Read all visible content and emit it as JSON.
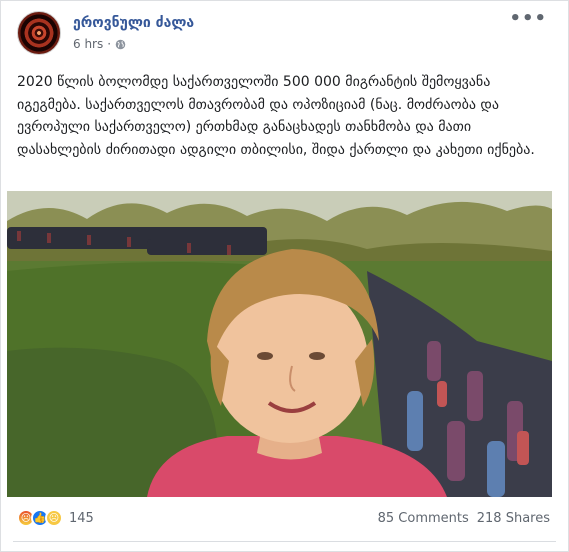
{
  "post": {
    "page_name": "ეროვნული ძალა",
    "timestamp": "6 hrs",
    "separator": "·",
    "text": "2020 წლის ბოლომდე საქართველოში 500 000 მიგრანტის შემოყვანა იგეგმება. საქართველოს მთავრობამ და ოპოზიციამ (ნაც. მოძრაობა და ევროპული საქართველო) ერთხმად განაცხადეს თანხმობა და მათი დასახლების ძირითადი ადგილი თბილისი, შიდა ქართლი და კახეთი იქნება."
  },
  "footer": {
    "reactions_count": "145",
    "comments": "85 Comments",
    "shares": "218 Shares"
  },
  "icons": [
    "globe-icon",
    "more-options-icon",
    "angry-icon",
    "like-icon",
    "sad-icon"
  ],
  "colors": {
    "page_name": "#365899",
    "meta": "#616770",
    "like": "#1877f2"
  }
}
